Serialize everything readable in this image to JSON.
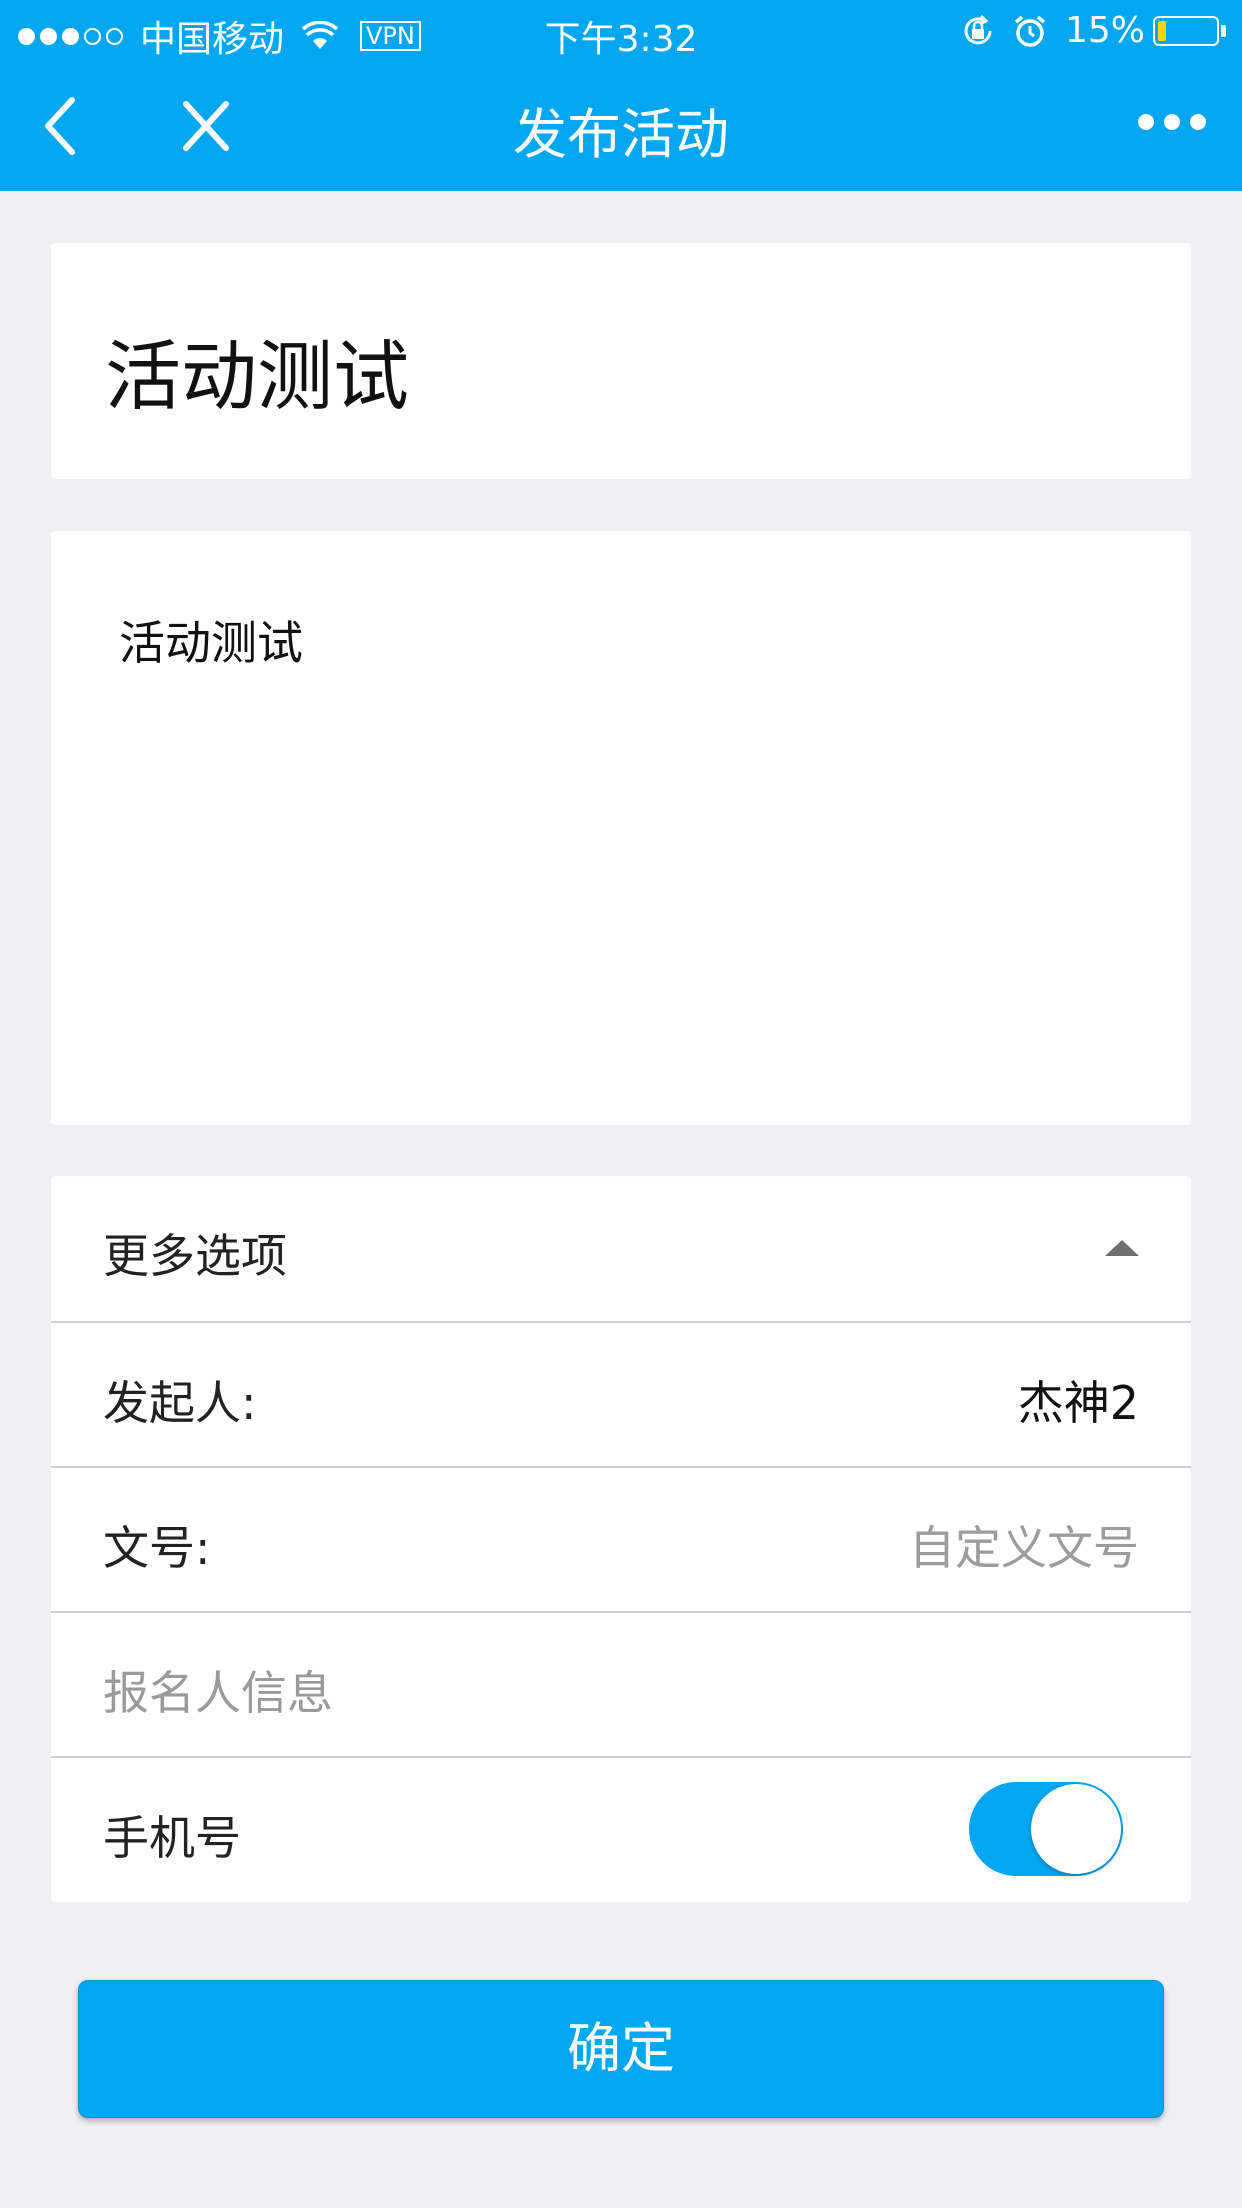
{
  "status_bar": {
    "carrier": "中国移动",
    "vpn": "VPN",
    "time": "下午3:32",
    "battery_percent": "15%",
    "battery_level": 0.15,
    "signal_bars": 3,
    "signal_total": 5
  },
  "nav": {
    "title": "发布活动"
  },
  "form": {
    "title": "活动测试",
    "content": "活动测试"
  },
  "options": {
    "header_label": "更多选项",
    "initiator_label": "发起人:",
    "initiator_value": "杰神2",
    "doc_number_label": "文号:",
    "doc_number_placeholder": "自定义文号",
    "signup_section_label": "报名人信息",
    "phone_label": "手机号",
    "phone_enabled": true
  },
  "confirm_label": "确定",
  "colors": {
    "accent": "#02a6f1",
    "background": "#f0eff4"
  }
}
